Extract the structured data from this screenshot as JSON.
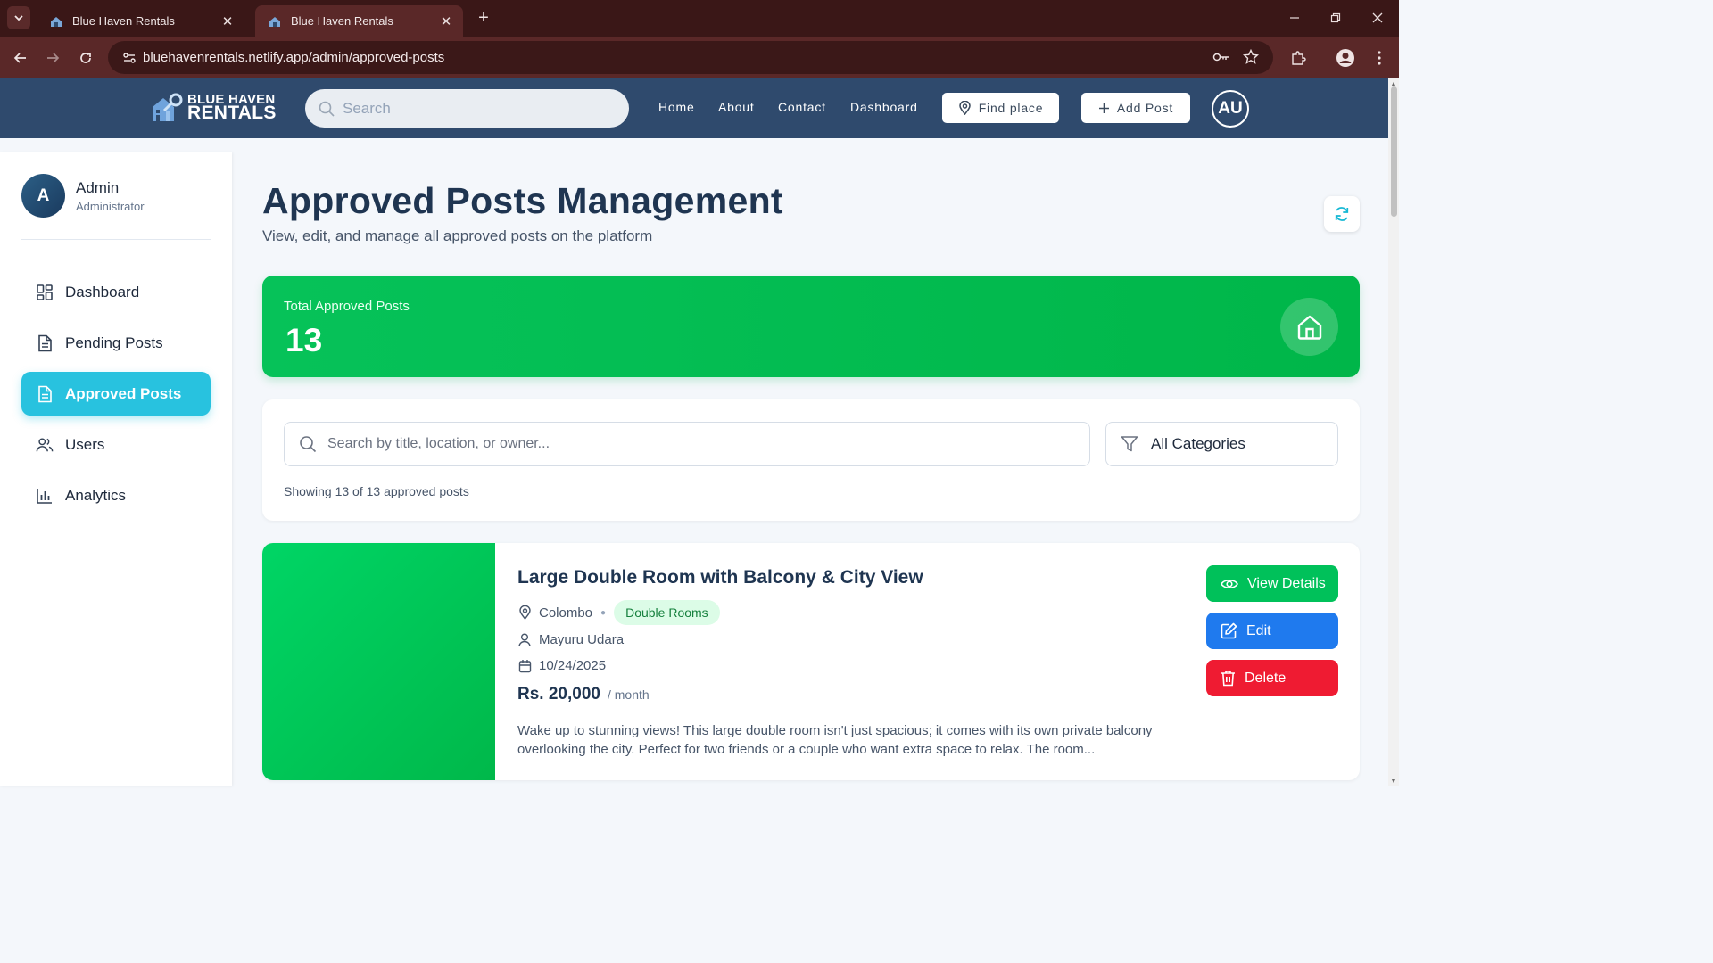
{
  "browser": {
    "tabs": [
      {
        "title": "Blue Haven Rentals",
        "active": false
      },
      {
        "title": "Blue Haven Rentals",
        "active": true
      }
    ],
    "url": "bluehavenrentals.netlify.app/admin/approved-posts"
  },
  "header": {
    "logo_line1": "BLUE HAVEN",
    "logo_line2": "RENTALS",
    "search_placeholder": "Search",
    "nav": [
      "Home",
      "About",
      "Contact",
      "Dashboard"
    ],
    "find_place": "Find place",
    "add_post": "Add Post",
    "user_initials": "AU"
  },
  "sidebar": {
    "avatar_initial": "A",
    "user_name": "Admin",
    "user_role": "Administrator",
    "items": [
      {
        "label": "Dashboard",
        "icon": "dashboard-grid-icon"
      },
      {
        "label": "Pending Posts",
        "icon": "document-icon"
      },
      {
        "label": "Approved Posts",
        "icon": "document-icon",
        "active": true
      },
      {
        "label": "Users",
        "icon": "users-icon"
      },
      {
        "label": "Analytics",
        "icon": "bar-chart-icon"
      }
    ]
  },
  "main": {
    "title": "Approved Posts Management",
    "subtitle": "View, edit, and manage all approved posts on the platform",
    "stat": {
      "label": "Total Approved Posts",
      "value": "13"
    },
    "filter": {
      "search_placeholder": "Search by title, location, or owner...",
      "category": "All Categories",
      "count_text": "Showing 13 of 13 approved posts"
    },
    "posts": [
      {
        "title": "Large Double Room with Balcony & City View",
        "location": "Colombo",
        "category": "Double Rooms",
        "owner": "Mayuru Udara",
        "date": "10/24/2025",
        "price": "Rs. 20,000",
        "period": "/ month",
        "description": "Wake up to stunning views! This large double room isn't just spacious; it comes with its own private balcony overlooking the city. Perfect for two friends or a couple who want extra space to relax. The room...",
        "actions": {
          "view": "View Details",
          "edit": "Edit",
          "delete": "Delete"
        }
      }
    ]
  },
  "colors": {
    "header_bg": "#2f4a6d",
    "accent_cyan": "#28c2df",
    "success_green": "#00c15a",
    "edit_blue": "#1f7aee",
    "delete_red": "#ef1b32"
  }
}
